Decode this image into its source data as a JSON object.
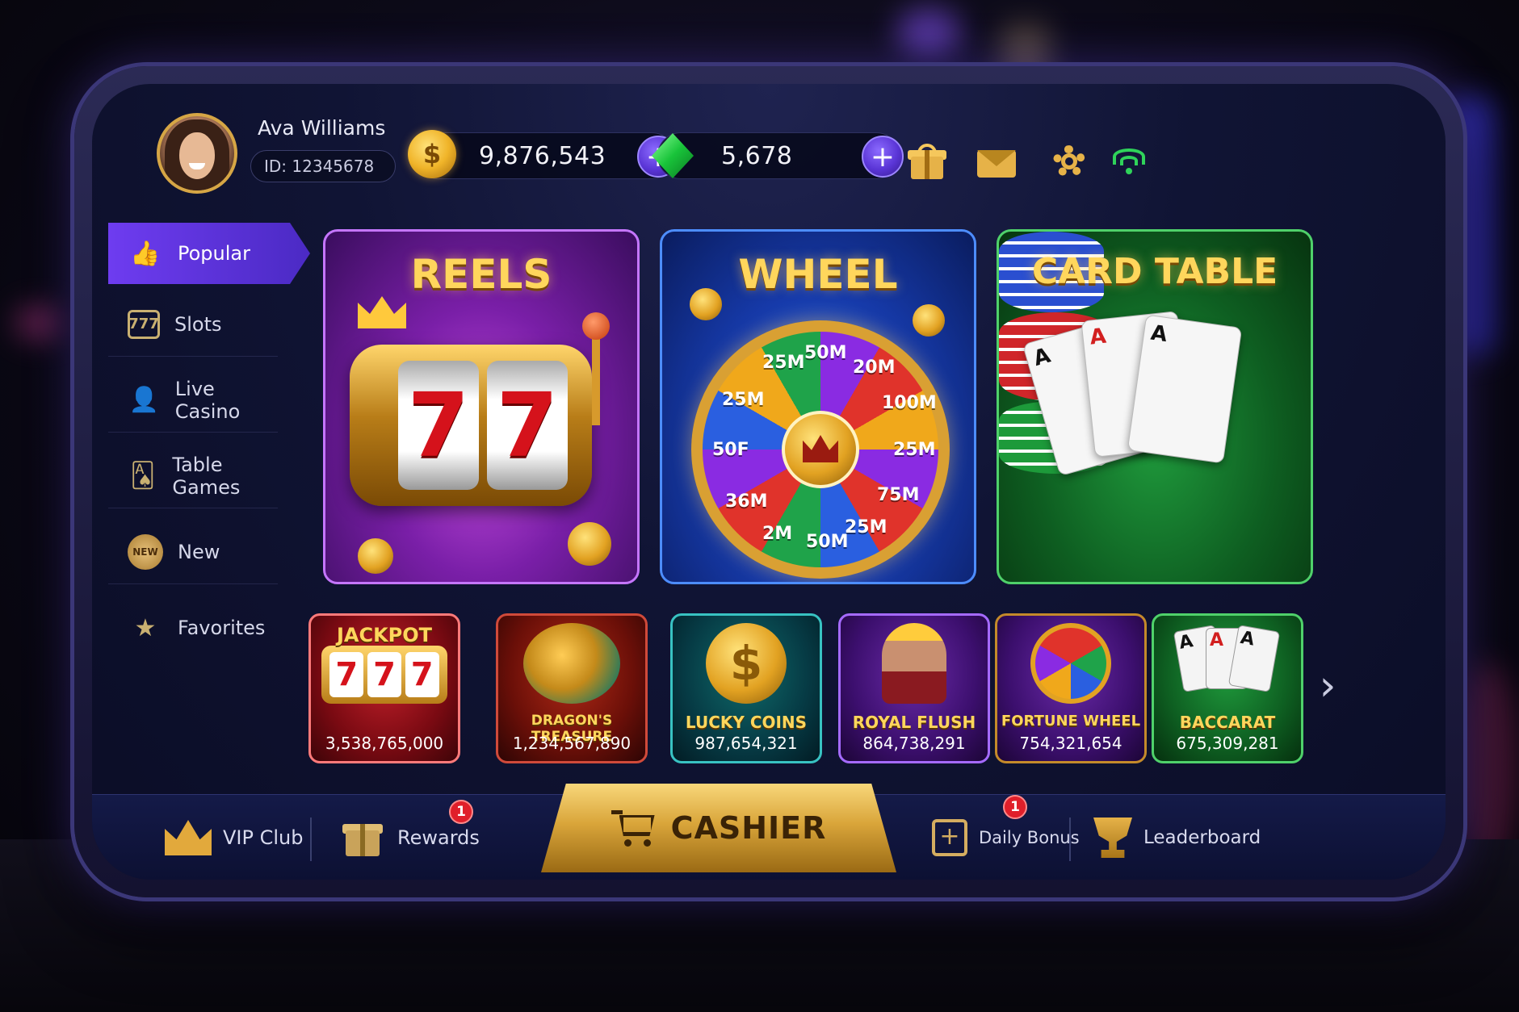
{
  "user": {
    "name": "Ava Williams",
    "id_label": "ID: 12345678"
  },
  "balances": {
    "coins": "9,876,543",
    "gems": "5,678",
    "coin_symbol": "$",
    "add_symbol": "+"
  },
  "header_icons": [
    "gift-icon",
    "mail-icon",
    "gear-icon",
    "wifi-icon"
  ],
  "sidebar": {
    "items": [
      {
        "label": "Popular",
        "icon": "thumbs-up-icon",
        "active": true
      },
      {
        "label": "Slots",
        "icon": "slot-777-icon"
      },
      {
        "label": "Live Casino",
        "icon": "live-dealer-icon"
      },
      {
        "label": "Table Games",
        "icon": "cards-icon"
      },
      {
        "label": "New",
        "icon": "new-badge-icon",
        "badge_text": "NEW"
      },
      {
        "label": "Favorites",
        "icon": "star-icon"
      }
    ]
  },
  "featured": [
    {
      "title": "REELS"
    },
    {
      "title": "WHEEL",
      "segments": [
        "50M",
        "20M",
        "100M",
        "25M",
        "75M",
        "25M",
        "50M",
        "25M",
        "50F",
        "25M",
        "36M",
        "2M"
      ]
    },
    {
      "title": "CARD TABLE",
      "cards": [
        "A",
        "A",
        "A"
      ]
    }
  ],
  "reels_symbols": [
    "7",
    "7"
  ],
  "games": [
    {
      "title": "JACKPOT",
      "value": "3,538,765,000",
      "art": "777"
    },
    {
      "title": "DRAGON'S TREASURE",
      "value": "1,234,567,890"
    },
    {
      "title": "LUCKY COINS",
      "value": "987,654,321",
      "art": "$"
    },
    {
      "title": "ROYAL FLUSH",
      "value": "864,738,291"
    },
    {
      "title": "FORTUNE WHEEL",
      "value": "754,321,654"
    },
    {
      "title": "BACCARAT",
      "value": "675,309,281",
      "cards": [
        "A",
        "A",
        "A"
      ]
    }
  ],
  "next_arrow": "›",
  "bottom_nav": {
    "vip": "VIP Club",
    "rewards": "Rewards",
    "rewards_badge": "1",
    "cashier": "CASHIER",
    "daily": "Daily Bonus",
    "daily_badge": "1",
    "leaderboard": "Leaderboard"
  },
  "colors": {
    "accent_purple": "#6e3cf0",
    "gold": "#ffd65c",
    "badge_red": "#e01f2a",
    "wifi_green": "#2fd35a"
  }
}
